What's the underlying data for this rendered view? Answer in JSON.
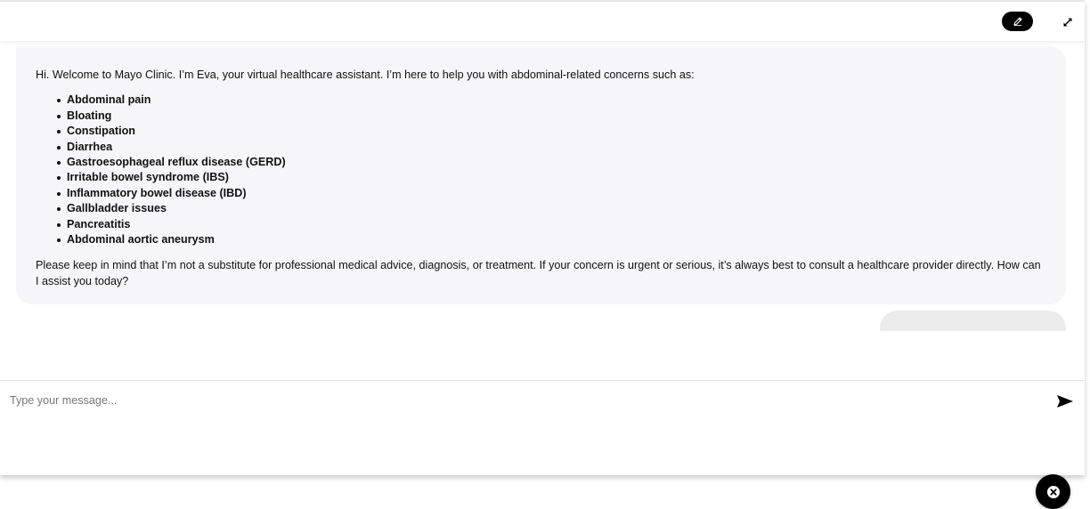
{
  "header": {
    "edit_icon": "pencil-icon",
    "expand_icon": "expand-arrows-icon"
  },
  "conversation": {
    "bot_message": {
      "intro": "Hi. Welcome to Mayo Clinic. I’m Eva, your virtual healthcare assistant. I’m here to help you with abdominal-related concerns such as:",
      "concerns": [
        "Abdominal pain",
        "Bloating",
        "Constipation",
        "Diarrhea",
        "Gastroesophageal reflux disease (GERD)",
        "Irritable bowel syndrome (IBS)",
        "Inflammatory bowel disease (IBD)",
        "Gallbladder issues",
        "Pancreatitis",
        "Abdominal aortic aneurysm"
      ],
      "closing": "Please keep in mind that I’m not a substitute for professional medical advice, diagnosis, or treatment. If your concern is urgent or serious, it’s always best to consult a healthcare provider directly. How can I assist you today?"
    }
  },
  "composer": {
    "placeholder": "Type your message...",
    "value": "",
    "send_icon": "send-icon"
  },
  "launcher": {
    "close_icon": "close-icon"
  },
  "colors": {
    "bot_bubble_bg": "#f6f6f8",
    "user_bubble_bg": "#ebebeb",
    "button_bg": "#000000"
  }
}
